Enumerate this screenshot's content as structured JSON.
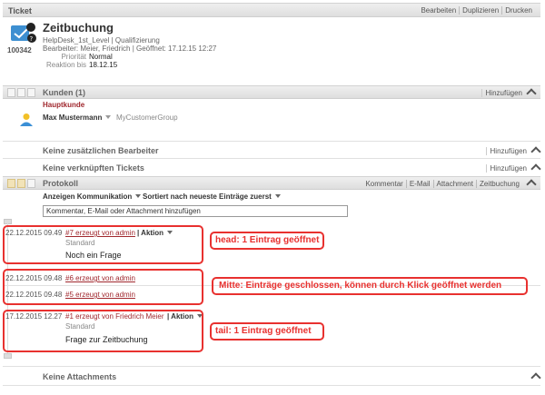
{
  "ticket_bar": {
    "title": "Ticket",
    "actions": [
      "Bearbeiten",
      "Duplizieren",
      "Drucken"
    ]
  },
  "ticket": {
    "number": "100342",
    "title": "Zeitbuchung",
    "group_line": "HelpDesk_1st_Level | Qualifizierung",
    "agent_line": "Bearbeiter: Meier, Friedrich | Geöffnet: 17.12.15 12:27",
    "priority_label": "Priorität",
    "priority_value": "Normal",
    "reaction_label": "Reaktion bis",
    "reaction_value": "18.12.15"
  },
  "customers": {
    "title": "Kunden (1)",
    "add": "Hinzufügen",
    "main_label": "Hauptkunde",
    "name": "Max Mustermann",
    "group": "MyCustomerGroup"
  },
  "extra_agents": {
    "title": "Keine zusätzlichen Bearbeiter",
    "add": "Hinzufügen"
  },
  "linked": {
    "title": "Keine verknüpften Tickets",
    "add": "Hinzufügen"
  },
  "protocol": {
    "title": "Protokoll",
    "actions": [
      "Kommentar",
      "E-Mail",
      "Attachment",
      "Zeitbuchung"
    ],
    "filter_show": "Anzeigen Kommunikation",
    "filter_sort": "Sortiert nach neueste Einträge zuerst",
    "input_value": "Kommentar, E-Mail oder Attachment hinzufügen"
  },
  "articles": {
    "a7": {
      "time": "22.12.2015 09.49",
      "link": "#7 erzeugt von admin",
      "action": "| Aktion",
      "type": "Standard",
      "text": "Noch ein Frage"
    },
    "a6": {
      "time": "22.12.2015 09.48",
      "link": "#6 erzeugt von admin"
    },
    "a5": {
      "time": "22.12.2015 09.48",
      "link": "#5 erzeugt von admin"
    },
    "a1": {
      "time": "17.12.2015 12.27",
      "link": "#1 erzeugt von Friedrich Meier",
      "action": "| Aktion",
      "type": "Standard",
      "text": "Frage zur Zeitbuchung"
    }
  },
  "annotations": {
    "head": "head: 1 Eintrag geöffnet",
    "middle": "Mitte: Einträge geschlossen, können durch Klick geöffnet werden",
    "tail": "tail: 1 Eintrag geöffnet"
  },
  "attachments": {
    "title": "Keine Attachments"
  },
  "colors": {
    "accent_red": "#a0282e",
    "annotation_red": "#e8312f",
    "bar_bg": "#e4e4e4"
  }
}
